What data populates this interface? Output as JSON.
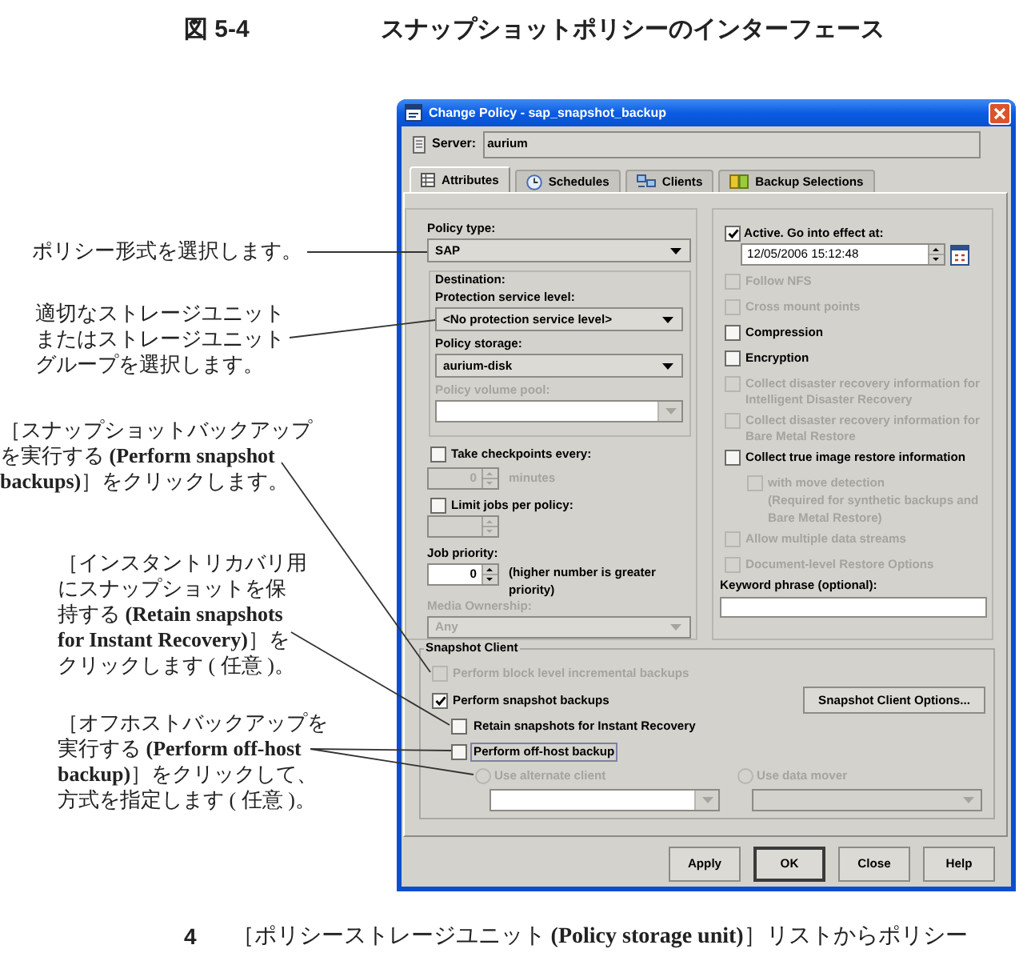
{
  "figure": {
    "number": "図 5-4",
    "title": "スナップショットポリシーのインターフェース"
  },
  "callouts": [
    {
      "lines": [
        "ポリシー形式を選択します。"
      ]
    },
    {
      "lines": [
        "適切なストレージユニット",
        "またはストレージユニット",
        "グループを選択します。"
      ]
    },
    {
      "lines": [
        "［スナップショットバックアップ",
        "を実行する **(Perform snapshot**",
        "**backups)**］をクリックします。"
      ]
    },
    {
      "lines": [
        "［インスタントリカバリ用",
        "にスナップショットを保",
        "持する **(Retain snapshots**",
        "**for Instant Recovery)**］を",
        "クリックします ( 任意 )。"
      ]
    },
    {
      "lines": [
        "［オフホストバックアップを",
        "実行する **(Perform off-host**",
        "**backup)**］をクリックして、",
        "方式を指定します ( 任意 )。"
      ]
    }
  ],
  "dialog": {
    "title": "Change Policy - sap_snapshot_backup",
    "server": {
      "label": "Server:",
      "value": "aurium"
    },
    "tabs": [
      {
        "label": "Attributes",
        "selected": true
      },
      {
        "label": "Schedules",
        "selected": false
      },
      {
        "label": "Clients",
        "selected": false
      },
      {
        "label": "Backup Selections",
        "selected": false
      }
    ],
    "policy_type": {
      "label": "Policy type:",
      "value": "SAP"
    },
    "destination": {
      "title": "Destination:",
      "fields": [
        {
          "kind": "dropdown",
          "label": "Protection service level:",
          "value": "<No protection service level>",
          "disabled": false
        },
        {
          "kind": "dropdown",
          "label": "Policy storage:",
          "value": "aurium-disk",
          "disabled": false
        },
        {
          "kind": "combo",
          "label": "Policy volume pool:",
          "disabled": true
        }
      ]
    },
    "limits": [
      {
        "label": "Take checkpoints every:",
        "checked": false,
        "value": "0",
        "unit": "minutes",
        "disabled": true
      },
      {
        "label": "Limit jobs per policy:",
        "checked": false,
        "disabled": true
      }
    ],
    "job_priority": {
      "label": "Job priority:",
      "value": "0",
      "hint": "(higher number is greater priority)"
    },
    "media_ownership": {
      "label": "Media Ownership:",
      "value": "Any",
      "disabled": true
    },
    "active": {
      "label": "Active. Go into effect at:",
      "checked": true,
      "value": "12/05/2006 15:12:48"
    },
    "options": [
      {
        "label": "Follow NFS",
        "checked": false,
        "disabled": true
      },
      {
        "label": "Cross mount points",
        "checked": false,
        "disabled": true
      },
      {
        "label": "Compression",
        "checked": false,
        "disabled": false
      },
      {
        "label": "Encryption",
        "checked": false,
        "disabled": false
      },
      {
        "label": "Collect disaster recovery information for Intelligent Disaster Recovery",
        "checked": false,
        "disabled": true
      },
      {
        "label": "Collect disaster recovery information for Bare Metal Restore",
        "checked": false,
        "disabled": true
      },
      {
        "label": "Collect true image restore information",
        "checked": false,
        "disabled": false,
        "children": [
          {
            "label": "with move detection",
            "checked": false,
            "disabled": true,
            "note": "(Required for synthetic backups and Bare Metal Restore)"
          }
        ]
      },
      {
        "label": "Allow multiple data streams",
        "checked": false,
        "disabled": true
      },
      {
        "label": "Document-level Restore Options",
        "checked": false,
        "disabled": true
      }
    ],
    "keyword": {
      "label": "Keyword phrase (optional):"
    },
    "snapshot_client": {
      "title": "Snapshot Client",
      "block_level": {
        "label": "Perform block level incremental backups",
        "checked": false,
        "disabled": true
      },
      "snapshot": {
        "label": "Perform snapshot backups",
        "checked": true,
        "disabled": false,
        "children": [
          {
            "label": "Retain snapshots for Instant Recovery",
            "checked": false,
            "disabled": false,
            "focused": false
          },
          {
            "label": "Perform off-host backup",
            "checked": false,
            "disabled": false,
            "focused": true
          }
        ]
      },
      "options_button": "Snapshot Client Options...",
      "methods": [
        {
          "label": "Use alternate client",
          "selected": false,
          "disabled": true,
          "field_disabled": false
        },
        {
          "label": "Use data mover",
          "selected": false,
          "disabled": true,
          "field_disabled": true
        }
      ]
    },
    "buttons": [
      {
        "label": "Apply",
        "default": false
      },
      {
        "label": "OK",
        "default": true
      },
      {
        "label": "Close",
        "default": false
      },
      {
        "label": "Help",
        "default": false
      }
    ]
  },
  "step": {
    "number": "4",
    "text": "［ポリシーストレージユニット **(Policy storage unit)**］リストからポリシー"
  }
}
